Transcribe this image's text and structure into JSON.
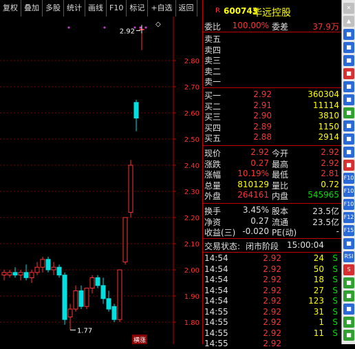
{
  "toolbar": {
    "items": [
      "复权",
      "叠加",
      "多股",
      "统计",
      "画线",
      "F10",
      "标记",
      "+自选",
      "返回"
    ]
  },
  "chart": {
    "y_ticks": [
      "2.80",
      "2.70",
      "2.60",
      "2.50",
      "2.40",
      "2.30",
      "2.20",
      "2.10",
      "2.00",
      "1.90",
      "1.80"
    ],
    "high_label": "2.92",
    "low_label": "1.77",
    "tag_label": "横涨"
  },
  "chart_data": {
    "type": "candlestick",
    "y_range": [
      1.77,
      2.92
    ],
    "candles": [
      {
        "o": 1.98,
        "h": 2.0,
        "l": 1.96,
        "c": 1.99
      },
      {
        "o": 1.98,
        "h": 2.0,
        "l": 1.97,
        "c": 1.99
      },
      {
        "o": 1.99,
        "h": 2.01,
        "l": 1.97,
        "c": 1.98
      },
      {
        "o": 1.98,
        "h": 2.0,
        "l": 1.96,
        "c": 1.99
      },
      {
        "o": 1.99,
        "h": 2.02,
        "l": 1.96,
        "c": 1.97
      },
      {
        "o": 1.97,
        "h": 2.0,
        "l": 1.95,
        "c": 1.99
      },
      {
        "o": 1.99,
        "h": 2.03,
        "l": 1.98,
        "c": 2.01
      },
      {
        "o": 2.01,
        "h": 2.05,
        "l": 1.99,
        "c": 2.04
      },
      {
        "o": 2.04,
        "h": 2.05,
        "l": 1.99,
        "c": 2.0
      },
      {
        "o": 2.0,
        "h": 2.03,
        "l": 1.98,
        "c": 2.01
      },
      {
        "o": 2.01,
        "h": 2.02,
        "l": 1.97,
        "c": 1.98
      },
      {
        "o": 1.98,
        "h": 1.99,
        "l": 1.79,
        "c": 1.81
      },
      {
        "o": 1.82,
        "h": 1.87,
        "l": 1.77,
        "c": 1.85
      },
      {
        "o": 1.85,
        "h": 1.94,
        "l": 1.84,
        "c": 1.92
      },
      {
        "o": 1.92,
        "h": 1.94,
        "l": 1.85,
        "c": 1.86
      },
      {
        "o": 1.86,
        "h": 1.93,
        "l": 1.85,
        "c": 1.93
      },
      {
        "o": 1.93,
        "h": 1.98,
        "l": 1.91,
        "c": 1.97
      },
      {
        "o": 1.97,
        "h": 1.98,
        "l": 1.93,
        "c": 1.94
      },
      {
        "o": 1.94,
        "h": 1.97,
        "l": 1.87,
        "c": 1.89
      },
      {
        "o": 1.89,
        "h": 1.92,
        "l": 1.84,
        "c": 1.85
      },
      {
        "o": 1.86,
        "h": 1.87,
        "l": 1.8,
        "c": 1.81
      },
      {
        "o": 1.81,
        "h": 2.0,
        "l": 1.8,
        "c": 2.0
      },
      {
        "o": 2.03,
        "h": 2.2,
        "l": 2.02,
        "c": 2.2
      },
      {
        "o": 2.22,
        "h": 2.42,
        "l": 2.2,
        "c": 2.4
      },
      {
        "o": 2.64,
        "h": 2.65,
        "l": 2.53,
        "c": 2.58
      },
      {
        "o": 2.92,
        "h": 2.92,
        "l": 2.84,
        "c": 2.92
      }
    ]
  },
  "quote": {
    "code": "600743",
    "name": "华远控股",
    "mark": "R",
    "weibi": {
      "label": "委比",
      "value": "100.00%",
      "label2": "委差",
      "value2": "37.9万"
    },
    "sells": [
      {
        "label": "卖五",
        "price": "",
        "vol": ""
      },
      {
        "label": "卖四",
        "price": "",
        "vol": ""
      },
      {
        "label": "卖三",
        "price": "",
        "vol": ""
      },
      {
        "label": "卖二",
        "price": "",
        "vol": ""
      },
      {
        "label": "卖一",
        "price": "",
        "vol": ""
      }
    ],
    "buys": [
      {
        "label": "买一",
        "price": "2.92",
        "vol": "360304"
      },
      {
        "label": "买二",
        "price": "2.91",
        "vol": "11114"
      },
      {
        "label": "买三",
        "price": "2.90",
        "vol": "3810"
      },
      {
        "label": "买四",
        "price": "2.89",
        "vol": "1150"
      },
      {
        "label": "买五",
        "price": "2.88",
        "vol": "2914"
      }
    ],
    "stats": [
      {
        "l1": "现价",
        "v1": "2.92",
        "l2": "今开",
        "v2": "2.92",
        "c1": "red",
        "c2": "red"
      },
      {
        "l1": "涨跌",
        "v1": "0.27",
        "l2": "最高",
        "v2": "2.92",
        "c1": "red",
        "c2": "red"
      },
      {
        "l1": "涨幅",
        "v1": "10.19%",
        "l2": "最低",
        "v2": "2.81",
        "c1": "red",
        "c2": "red"
      },
      {
        "l1": "总量",
        "v1": "810129",
        "l2": "量比",
        "v2": "0.72",
        "c1": "yel",
        "c2": "yel"
      },
      {
        "l1": "外盘",
        "v1": "264161",
        "l2": "内盘",
        "v2": "545965",
        "c1": "red",
        "c2": "grn"
      }
    ],
    "stats2": [
      {
        "l1": "换手",
        "v1": "3.45%",
        "l2": "股本",
        "v2": "23.5亿"
      },
      {
        "l1": "净资",
        "v1": "0.27",
        "l2": "流通",
        "v2": "23.5亿"
      },
      {
        "l1": "收益(三)",
        "v1": "-0.020",
        "l2": "PE(动)",
        "v2": "-"
      }
    ],
    "status_label": "交易状态:",
    "status_value": "闭市阶段",
    "status_time": "15:00:04",
    "ticks": [
      {
        "t": "14:54",
        "p": "2.92",
        "v": "24",
        "s": "S"
      },
      {
        "t": "14:54",
        "p": "2.92",
        "v": "50",
        "s": "S"
      },
      {
        "t": "14:54",
        "p": "2.92",
        "v": "18",
        "s": "S"
      },
      {
        "t": "14:54",
        "p": "2.92",
        "v": "27",
        "s": "S"
      },
      {
        "t": "14:54",
        "p": "2.92",
        "v": "123",
        "s": "S"
      },
      {
        "t": "14:55",
        "p": "2.92",
        "v": "31",
        "s": "S"
      },
      {
        "t": "14:55",
        "p": "2.92",
        "v": "1",
        "s": "S"
      },
      {
        "t": "14:55",
        "p": "2.92",
        "v": "11",
        "s": "S"
      },
      {
        "t": "14:55",
        "p": "2.92",
        "v": "",
        "s": ""
      }
    ]
  },
  "sidebar": {
    "icons": [
      "✕",
      "▲",
      "■",
      "■",
      "■",
      "■",
      "■",
      "■",
      "■",
      "■",
      "■",
      "■",
      "■",
      "F10",
      "F10",
      "F10",
      "F12",
      "F15",
      "■",
      "RSI",
      "S",
      "■",
      "■",
      "■",
      "■",
      "■"
    ],
    "colors": [
      "#c0c0c0",
      "#c0c0c0",
      "#2a6ad8",
      "#2a6ad8",
      "#2a6ad8",
      "#d83030",
      "#2a6ad8",
      "#2a6ad8",
      "#30a030",
      "#2a6ad8",
      "#2a6ad8",
      "#2a6ad8",
      "#d83030",
      "#2a6ad8",
      "#2a6ad8",
      "#2a6ad8",
      "#2a6ad8",
      "#2a6ad8",
      "#2a6ad8",
      "#2a6ad8",
      "#d83030",
      "#30a030",
      "#30a030",
      "#2a6ad8",
      "#30a030",
      "#30a030"
    ]
  }
}
